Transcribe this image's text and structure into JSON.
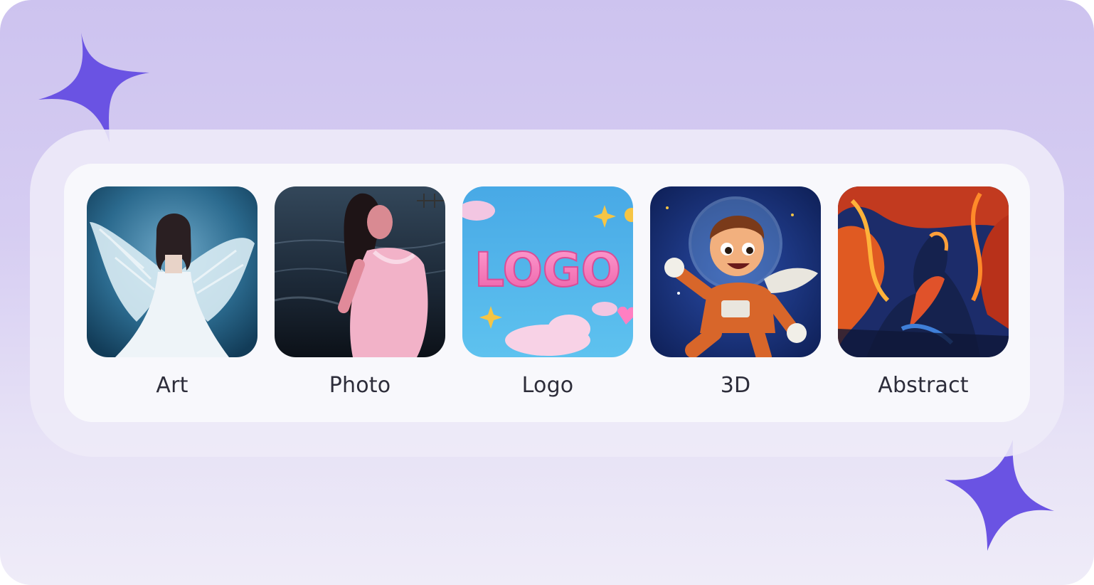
{
  "styles": [
    {
      "id": "art",
      "label": "Art",
      "image": "angel-woman-with-wings"
    },
    {
      "id": "photo",
      "label": "Photo",
      "image": "woman-in-pink-dress-at-beach"
    },
    {
      "id": "logo",
      "label": "Logo",
      "image": "pink-balloon-logo-text",
      "art_text": "LOGO"
    },
    {
      "id": "3d",
      "label": "3D",
      "image": "cartoon-astronaut-boy"
    },
    {
      "id": "abstract",
      "label": "Abstract",
      "image": "abstract-painted-figure"
    }
  ],
  "colors": {
    "background": "#cdc3ef",
    "card": "#f8f8fc",
    "sparkle": "#6a53e3",
    "label_text": "#2d2d3a"
  },
  "icons": [
    "sparkle-icon",
    "sparkle-icon"
  ]
}
